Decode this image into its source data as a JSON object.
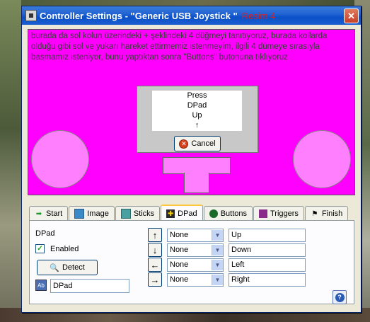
{
  "window": {
    "title": "Controller Settings - \"Generic   USB  Joystick \"",
    "overlay_label": "Resim 4"
  },
  "description": "burada da sol kolun üzerindeki + şeklindeki 4 düğmeyi tanıtıyoruz, burada kollarda olduğu gibi sol ve yukarı hareket ettirmemiz istenmeyim, ilgili 4 dümeye sırasıyla basmamız isteniyor, bunu yaptıktan sonra \"Buttons\" butonuna tıklıyoruz",
  "prompt": {
    "line1": "Press",
    "line2": "DPad",
    "line3": "Up",
    "arrow": "↑",
    "cancel_label": "Cancel"
  },
  "tabs": [
    {
      "label": "Start",
      "icon": "arrow-right-icon"
    },
    {
      "label": "Image",
      "icon": "image-icon"
    },
    {
      "label": "Sticks",
      "icon": "sticks-icon"
    },
    {
      "label": "DPad",
      "icon": "dpad-icon",
      "active": true
    },
    {
      "label": "Buttons",
      "icon": "buttons-icon"
    },
    {
      "label": "Triggers",
      "icon": "triggers-icon"
    },
    {
      "label": "Finish",
      "icon": "finish-flag-icon"
    }
  ],
  "dpad": {
    "section_label": "DPad",
    "enabled_label": "Enabled",
    "enabled": true,
    "detect_label": "Detect",
    "name_value": "DPad"
  },
  "mappings": [
    {
      "arrow": "↑",
      "select": "None",
      "name": "Up"
    },
    {
      "arrow": "↓",
      "select": "None",
      "name": "Down"
    },
    {
      "arrow": "←",
      "select": "None",
      "name": "Left"
    },
    {
      "arrow": "→",
      "select": "None",
      "name": "Right"
    }
  ],
  "colors": {
    "pink_panel": "#ff00ff",
    "pink_shapes": "#ff7fff",
    "titlebar": "#0b50c8"
  }
}
